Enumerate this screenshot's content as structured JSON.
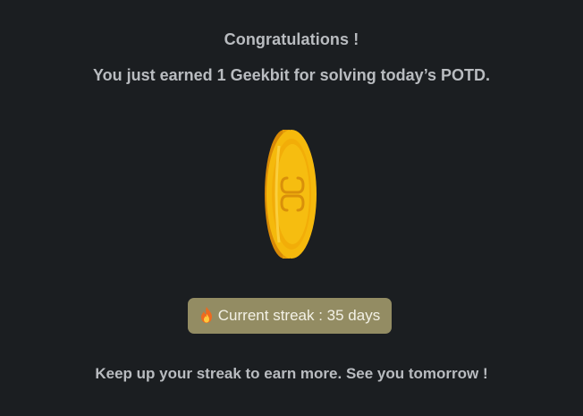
{
  "modal": {
    "title": "Congratulations !",
    "subtitle": "You just earned 1 Geekbit for solving today’s POTD.",
    "coin_icon": "geekbit-coin-icon",
    "streak": {
      "icon": "fire-icon",
      "label": "Current streak : 35 days"
    },
    "footer": "Keep up your streak to earn more. See you tomorrow !"
  },
  "colors": {
    "background": "#1b1e21",
    "text": "#b9bcc0",
    "badge_bg": "#938c63",
    "coin_gold": "#f5b90c"
  }
}
